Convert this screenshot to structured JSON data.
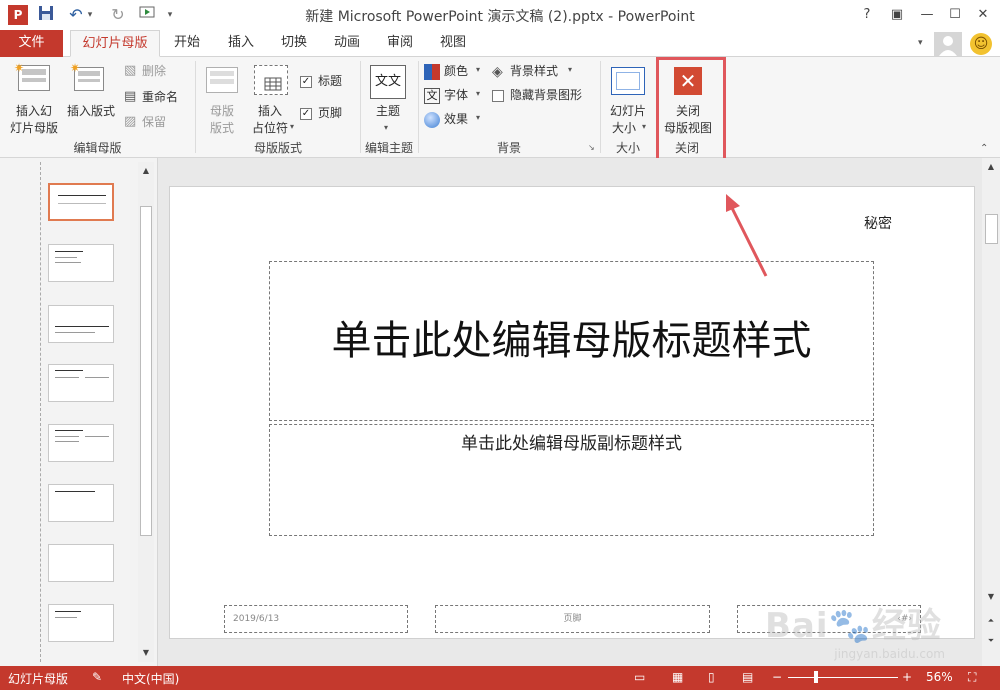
{
  "window": {
    "title": "新建 Microsoft PowerPoint 演示文稿 (2).pptx - PowerPoint",
    "help": "?",
    "restore_ribbon": "▣",
    "minimize": "—",
    "maximize": "☐",
    "close": "✕"
  },
  "qat": {
    "undo_arrow": "▾",
    "customize": "▾"
  },
  "tabs": {
    "file": "文件",
    "slide_master": "幻灯片母版",
    "home": "开始",
    "insert": "插入",
    "transitions": "切换",
    "animations": "动画",
    "review": "审阅",
    "view": "视图"
  },
  "ribbon": {
    "edit_master": {
      "label": "编辑母版",
      "insert_slide_master": [
        "插入幻",
        "灯片母版"
      ],
      "insert_layout": "插入版式",
      "delete": "删除",
      "rename": "重命名",
      "preserve": "保留"
    },
    "master_layout": {
      "label": "母版版式",
      "master_layout_btn": [
        "母版",
        "版式"
      ],
      "insert_placeholder": [
        "插入",
        "占位符"
      ],
      "title_checkbox": "标题",
      "footer_checkbox": "页脚"
    },
    "edit_theme": {
      "label": "编辑主题",
      "themes": "主题",
      "theme_icon_text": "文文"
    },
    "background": {
      "label": "背景",
      "colors": "颜色",
      "fonts": "字体",
      "effects": "效果",
      "background_styles": "背景样式",
      "hide_bg_graphics": "隐藏背景图形"
    },
    "size": {
      "label": "大小",
      "slide_size": [
        "幻灯片",
        "大小"
      ]
    },
    "close": {
      "label": "关闭",
      "close_master_view": [
        "关闭",
        "母版视图"
      ]
    }
  },
  "slide": {
    "confidential": "秘密",
    "title": "单击此处编辑母版标题样式",
    "subtitle": "单击此处编辑母版副标题样式",
    "date": "2019/6/13",
    "footer": "页脚",
    "slide_number": "‹#›"
  },
  "status": {
    "view_name": "幻灯片母版",
    "language": "中文(中国)",
    "zoom": "56%",
    "zoom_minus": "−",
    "zoom_plus": "+"
  },
  "colors": {
    "accent": "#c4392d",
    "highlight_box": "#e0575c"
  }
}
